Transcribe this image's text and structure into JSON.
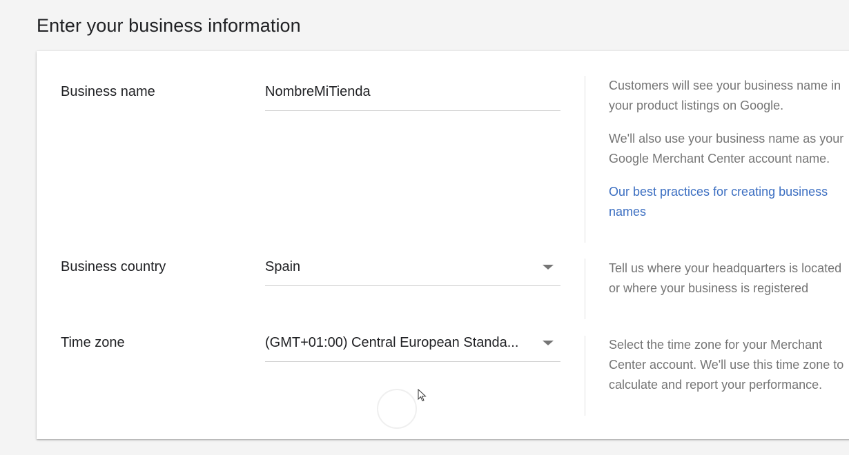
{
  "page": {
    "title": "Enter your business information"
  },
  "business_name": {
    "label": "Business name",
    "value": "NombreMiTienda",
    "help": [
      "Customers will see your business name in your product listings on Google.",
      "We'll also use your business name as your Google Merchant Center account name."
    ],
    "link": "Our best practices for creating business names"
  },
  "business_country": {
    "label": "Business country",
    "value": "Spain",
    "help": "Tell us where your headquarters is located or where your business is registered"
  },
  "time_zone": {
    "label": "Time zone",
    "value": "(GMT+01:00) Central European Standa...",
    "help": "Select the time zone for your Merchant Center account. We'll use this time zone to calculate and report your performance."
  },
  "colors": {
    "link": "#3b6ec1",
    "help_text": "#757575",
    "text": "#202124"
  }
}
